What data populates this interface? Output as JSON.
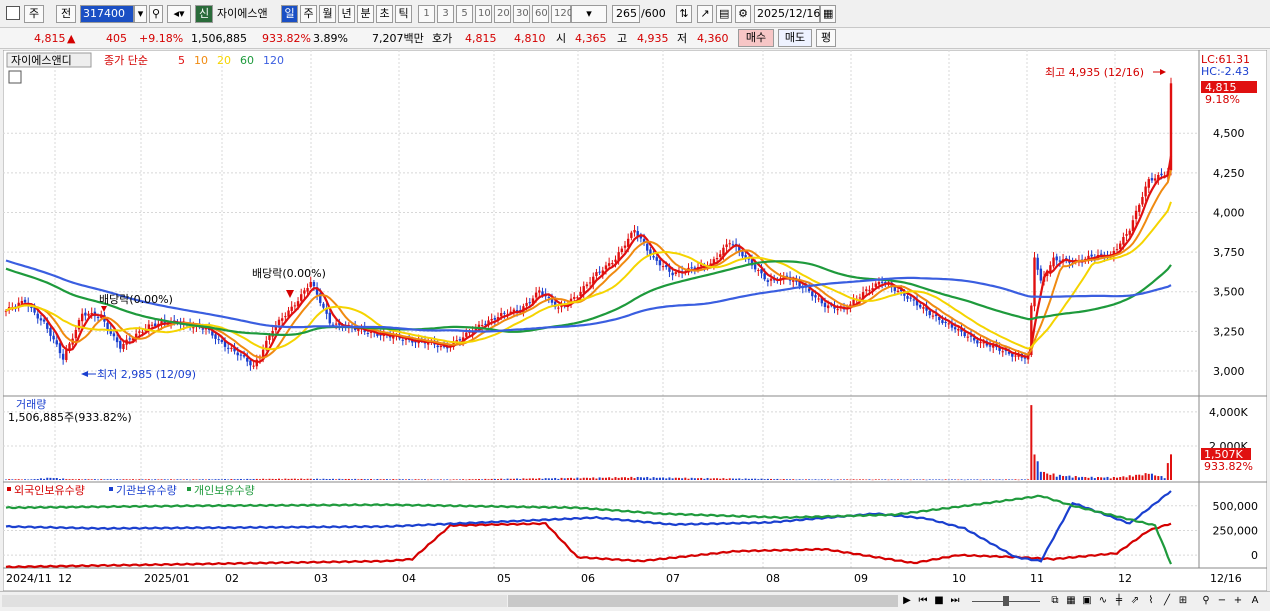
{
  "toolbar": {
    "market_label": "주",
    "prev_label": "전",
    "code": "317400",
    "new_label": "신",
    "stock_name": "자이에스앤",
    "periods": [
      "일",
      "주",
      "월",
      "년",
      "분",
      "초",
      "틱"
    ],
    "active_period": "일",
    "intervals": [
      "1",
      "3",
      "5",
      "10",
      "20",
      "30",
      "60",
      "120"
    ],
    "count": "265",
    "count_max": "/600",
    "date": "2025/12/16"
  },
  "quote": {
    "price": "4,815",
    "arrow": "▲",
    "change": "405",
    "change_pct": "+9.18%",
    "volume": "1,506,885",
    "volume_pct": "933.82%",
    "turnover": "3.89%",
    "amount": "7,207백만",
    "bid_label": "호가",
    "ask_price": "4,815",
    "bid_price": "4,810",
    "open_label": "시",
    "open": "4,365",
    "high_label": "고",
    "high": "4,935",
    "low_label": "저",
    "low": "4,360",
    "buy_label": "매수",
    "sell_label": "매도",
    "avg_label": "평"
  },
  "price_panel": {
    "stock_tag": "자이에스앤디",
    "ma_label": "종가 단순",
    "ma_periods": [
      "5",
      "10",
      "20",
      "60",
      "120"
    ],
    "ma_colors": [
      "#e01010",
      "#f08a10",
      "#f5d400",
      "#1e9a3c",
      "#3a5ee0"
    ],
    "lc": "LC:61.31",
    "hc": "HC:-2.43",
    "high_note": "최고 4,935 (12/16)",
    "low_note": "최저 2,985 (12/09)",
    "dividend_note_1": "배당락(0.00%)",
    "dividend_note_2": "배당락(0.00%)",
    "last_price_tag": "4,815",
    "last_pct_tag": "9.18%"
  },
  "volume_panel": {
    "title": "거래량",
    "subtitle": "1,506,885주(933.82%)",
    "last_tag": "1,507K",
    "last_pct": "933.82%"
  },
  "holding_panel": {
    "legend": [
      {
        "label": "외국인보유수량",
        "color": "#d40000"
      },
      {
        "label": "기관보유수량",
        "color": "#1a3fcf"
      },
      {
        "label": "개인보유수량",
        "color": "#1e9a3c"
      }
    ]
  },
  "chart_data": {
    "type": "candlestick",
    "price_ticks": [
      3000,
      3250,
      3500,
      3750,
      4000,
      4250,
      4500
    ],
    "price_tick_labels": [
      "3,000",
      "3,250",
      "3,500",
      "3,750",
      "4,000",
      "4,250",
      "4,500"
    ],
    "price_range": [
      2880,
      5000
    ],
    "volume_ticks": [
      2000,
      4000
    ],
    "volume_tick_labels": [
      "2,000K",
      "4,000K"
    ],
    "volume_range": [
      0,
      4700
    ],
    "holding_ticks": [
      0,
      250000,
      500000
    ],
    "holding_tick_labels": [
      "0",
      "250,000",
      "500,000"
    ],
    "holding_range": [
      -110000,
      700000
    ],
    "x_labels": [
      "2024/11",
      "12",
      "2025/01",
      "02",
      "03",
      "04",
      "05",
      "06",
      "07",
      "08",
      "09",
      "10",
      "11",
      "12",
      "12/16"
    ],
    "close_key": [
      [
        0,
        3380
      ],
      [
        6,
        3440
      ],
      [
        12,
        3300
      ],
      [
        18,
        3080
      ],
      [
        24,
        3360
      ],
      [
        30,
        3340
      ],
      [
        36,
        3150
      ],
      [
        45,
        3290
      ],
      [
        54,
        3310
      ],
      [
        63,
        3260
      ],
      [
        72,
        3120
      ],
      [
        78,
        3030
      ],
      [
        84,
        3260
      ],
      [
        90,
        3400
      ],
      [
        96,
        3560
      ],
      [
        102,
        3310
      ],
      [
        108,
        3270
      ],
      [
        114,
        3250
      ],
      [
        120,
        3220
      ],
      [
        126,
        3200
      ],
      [
        132,
        3180
      ],
      [
        138,
        3150
      ],
      [
        144,
        3210
      ],
      [
        150,
        3300
      ],
      [
        156,
        3350
      ],
      [
        162,
        3390
      ],
      [
        168,
        3500
      ],
      [
        174,
        3400
      ],
      [
        180,
        3470
      ],
      [
        186,
        3620
      ],
      [
        192,
        3700
      ],
      [
        198,
        3900
      ],
      [
        204,
        3700
      ],
      [
        210,
        3620
      ],
      [
        216,
        3640
      ],
      [
        222,
        3680
      ],
      [
        228,
        3810
      ],
      [
        234,
        3700
      ],
      [
        240,
        3560
      ],
      [
        246,
        3600
      ],
      [
        252,
        3510
      ],
      [
        258,
        3420
      ],
      [
        264,
        3380
      ],
      [
        270,
        3500
      ],
      [
        276,
        3560
      ],
      [
        282,
        3500
      ],
      [
        288,
        3400
      ],
      [
        294,
        3330
      ],
      [
        300,
        3250
      ],
      [
        306,
        3190
      ],
      [
        312,
        3140
      ],
      [
        318,
        3100
      ],
      [
        322,
        3080
      ],
      [
        324,
        3720
      ],
      [
        326,
        3560
      ],
      [
        330,
        3710
      ],
      [
        336,
        3680
      ],
      [
        342,
        3730
      ],
      [
        348,
        3720
      ],
      [
        354,
        3900
      ],
      [
        360,
        4200
      ],
      [
        366,
        4260
      ],
      [
        367,
        4815
      ]
    ],
    "volume_key": [
      [
        0,
        45
      ],
      [
        8,
        35
      ],
      [
        14,
        130
      ],
      [
        20,
        45
      ],
      [
        60,
        35
      ],
      [
        90,
        70
      ],
      [
        140,
        30
      ],
      [
        200,
        160
      ],
      [
        207,
        130
      ],
      [
        240,
        60
      ],
      [
        250,
        35
      ],
      [
        300,
        30
      ],
      [
        322,
        35
      ],
      [
        323,
        4400
      ],
      [
        324,
        1500
      ],
      [
        325,
        1100
      ],
      [
        326,
        480
      ],
      [
        328,
        380
      ],
      [
        332,
        260
      ],
      [
        340,
        160
      ],
      [
        350,
        150
      ],
      [
        360,
        360
      ],
      [
        365,
        160
      ],
      [
        367,
        1507
      ]
    ],
    "foreign_key": [
      [
        0,
        -120000
      ],
      [
        40,
        -100000
      ],
      [
        80,
        -80000
      ],
      [
        120,
        -60000
      ],
      [
        128,
        -40000
      ],
      [
        140,
        300000
      ],
      [
        170,
        320000
      ],
      [
        180,
        -20000
      ],
      [
        200,
        -60000
      ],
      [
        230,
        40000
      ],
      [
        258,
        60000
      ],
      [
        286,
        -80000
      ],
      [
        300,
        0
      ],
      [
        318,
        -20000
      ],
      [
        330,
        -40000
      ],
      [
        350,
        20000
      ],
      [
        360,
        250000
      ],
      [
        367,
        320000
      ]
    ],
    "institution_key": [
      [
        0,
        290000
      ],
      [
        30,
        270000
      ],
      [
        120,
        290000
      ],
      [
        186,
        380000
      ],
      [
        210,
        310000
      ],
      [
        240,
        330000
      ],
      [
        274,
        420000
      ],
      [
        290,
        370000
      ],
      [
        302,
        270000
      ],
      [
        318,
        -20000
      ],
      [
        326,
        -60000
      ],
      [
        336,
        530000
      ],
      [
        354,
        320000
      ],
      [
        367,
        650000
      ]
    ],
    "individual_key": [
      [
        0,
        480000
      ],
      [
        60,
        500000
      ],
      [
        120,
        510000
      ],
      [
        180,
        480000
      ],
      [
        206,
        420000
      ],
      [
        245,
        380000
      ],
      [
        280,
        410000
      ],
      [
        305,
        510000
      ],
      [
        326,
        600000
      ],
      [
        336,
        500000
      ],
      [
        362,
        300000
      ],
      [
        367,
        -90000
      ]
    ]
  }
}
